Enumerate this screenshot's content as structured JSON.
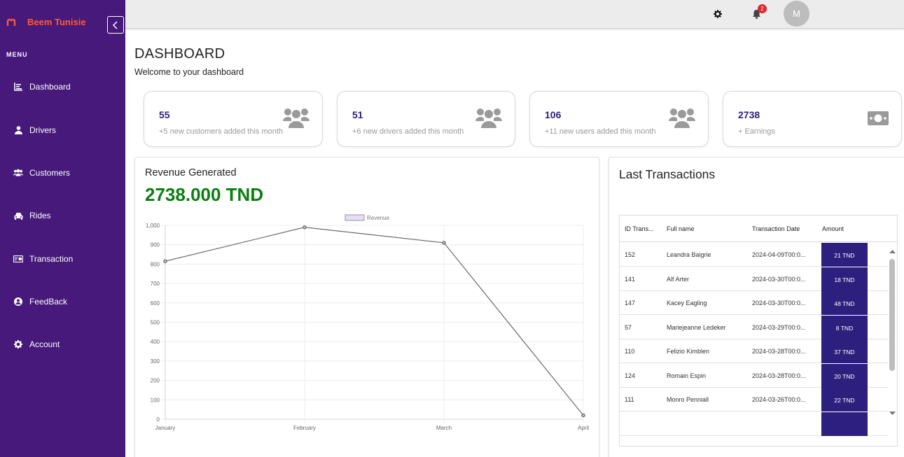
{
  "brand": {
    "name": "Beem Tunisie"
  },
  "menu": {
    "heading": "MENU",
    "items": [
      {
        "label": "Dashboard",
        "icon": "dashboard-icon"
      },
      {
        "label": "Drivers",
        "icon": "person-icon"
      },
      {
        "label": "Customers",
        "icon": "users-icon"
      },
      {
        "label": "Rides",
        "icon": "car-icon"
      },
      {
        "label": "Transaction",
        "icon": "card-icon"
      },
      {
        "label": "FeedBack",
        "icon": "user-circle-icon"
      },
      {
        "label": "Account",
        "icon": "gear-icon"
      }
    ]
  },
  "topbar": {
    "notification_count": "2",
    "avatar_initial": "M"
  },
  "header": {
    "title": "DASHBOARD",
    "subtitle": "Welcome to your dashboard"
  },
  "stats": [
    {
      "value": "55",
      "label": "+5 new customers added this month",
      "icon": "users-icon"
    },
    {
      "value": "51",
      "label": "+6 new drivers added this month",
      "icon": "users-icon"
    },
    {
      "value": "106",
      "label": "+11 new users added this month",
      "icon": "users-icon"
    },
    {
      "value": "2738",
      "label": "+ Earnings",
      "icon": "money-icon"
    }
  ],
  "revenue": {
    "title": "Revenue Generated",
    "amount": "2738.000 TND"
  },
  "chart_data": {
    "type": "line",
    "categories": [
      "January",
      "February",
      "March",
      "April"
    ],
    "series": [
      {
        "name": "Revenue",
        "values": [
          815,
          990,
          910,
          20
        ]
      }
    ],
    "ylim": [
      0,
      1000
    ],
    "yticks": [
      "1,000",
      "900",
      "800",
      "700",
      "600",
      "500",
      "400",
      "300",
      "200",
      "100",
      "0"
    ],
    "legend": "top",
    "grid": true
  },
  "transactions": {
    "title": "Last Transactions",
    "columns": [
      "ID Trans...",
      "Full name",
      "Transaction Date",
      "Amount"
    ],
    "rows": [
      {
        "id": "152",
        "name": "Leandra Baigrie",
        "date": "2024-04-09T00:0...",
        "amount": "21 TND"
      },
      {
        "id": "141",
        "name": "Alf Arter",
        "date": "2024-03-30T00:0...",
        "amount": "18 TND"
      },
      {
        "id": "147",
        "name": "Kacey Eagling",
        "date": "2024-03-30T00:0...",
        "amount": "48 TND"
      },
      {
        "id": "57",
        "name": "Mariejeanne Ledeker",
        "date": "2024-03-29T00:0...",
        "amount": "8 TND"
      },
      {
        "id": "110",
        "name": "Felizio Kimblen",
        "date": "2024-03-28T00:0...",
        "amount": "37 TND"
      },
      {
        "id": "124",
        "name": "Romain Espin",
        "date": "2024-03-28T00:0...",
        "amount": "20 TND"
      },
      {
        "id": "111",
        "name": "Monro Penniall",
        "date": "2024-03-26T00:0...",
        "amount": "22 TND"
      },
      {
        "id": "",
        "name": "",
        "date": "",
        "amount": ""
      }
    ]
  },
  "colors": {
    "sidebar": "#46197a",
    "brand": "#ff5a36",
    "stat_value": "#2b1f78",
    "revenue_amount": "#0a7f10",
    "amount_badge": "#2d1f7e",
    "notification": "#e0282e"
  }
}
